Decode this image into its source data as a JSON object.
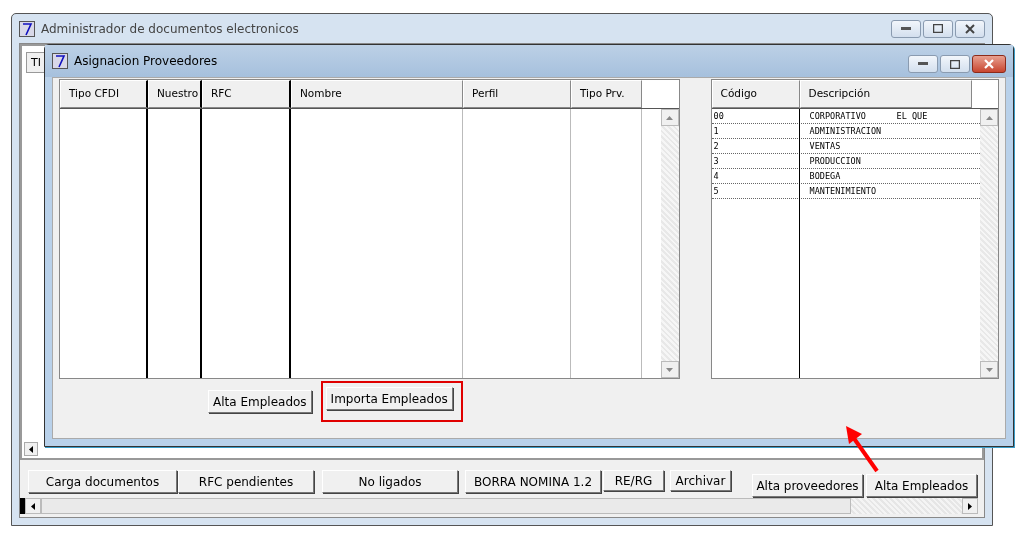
{
  "main_window": {
    "title": "Administrador de documentos electronicos",
    "tab_fragment": "TI",
    "buttons": [
      {
        "label": "Carga documentos"
      },
      {
        "label": "RFC pendientes"
      },
      {
        "label": "No ligados"
      },
      {
        "label": "BORRA NOMINA 1.2"
      },
      {
        "label": "RE/RG"
      },
      {
        "label": "Archivar"
      },
      {
        "label": "Alta proveedores"
      },
      {
        "label": "Alta Empleados"
      }
    ]
  },
  "dialog": {
    "title": "Asignacion Proveedores",
    "grid": {
      "columns": [
        "Tipo CFDI",
        "Nuestro",
        "RFC",
        "Nombre",
        "Perfil",
        "Tipo Prv."
      ]
    },
    "departments": {
      "columns": [
        "Código",
        "Descripción"
      ],
      "rows": [
        {
          "code": "00",
          "description": "CORPORATIVO      EL QUE"
        },
        {
          "code": "1",
          "description": "ADMINISTRACION"
        },
        {
          "code": "2",
          "description": "VENTAS"
        },
        {
          "code": "3",
          "description": "PRODUCCION"
        },
        {
          "code": "4",
          "description": "BODEGA"
        },
        {
          "code": "5",
          "description": "MANTENIMIENTO"
        }
      ]
    },
    "buttons": [
      {
        "label": "Alta Empleados",
        "highlighted": false
      },
      {
        "label": "Importa Empleados",
        "highlighted": true
      }
    ]
  }
}
